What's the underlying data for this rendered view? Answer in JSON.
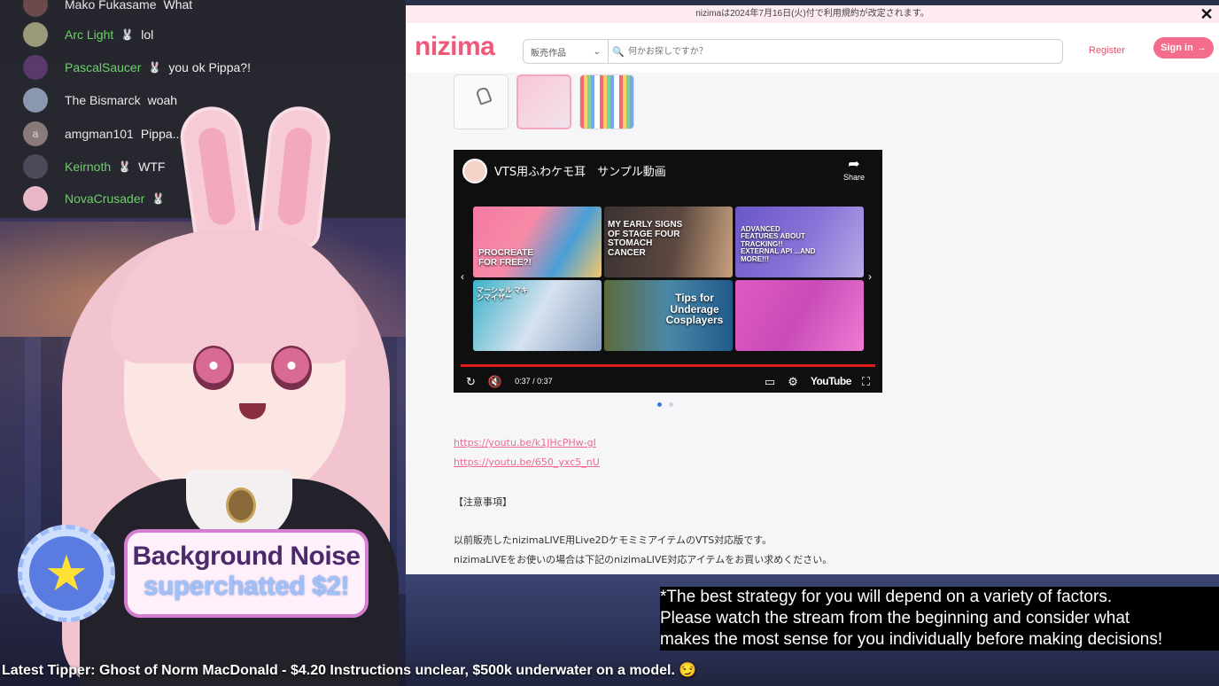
{
  "chat": {
    "messages": [
      {
        "name": "Mako Fukasame",
        "message": "What",
        "avatar_color": "#6a4a4a",
        "name_color": "white"
      },
      {
        "name": "Arc Light",
        "message": "lol",
        "avatar_color": "#9a9a7a",
        "name_color": "green",
        "badge": "🐰"
      },
      {
        "name": "PascalSaucer",
        "message": "you ok Pippa?!",
        "avatar_color": "#5a3a6a",
        "name_color": "green",
        "badge": "🐰"
      },
      {
        "name": "The Bismarck",
        "message": "woah",
        "avatar_color": "#8a98b0",
        "name_color": "white"
      },
      {
        "name": "amgman101",
        "message": "Pippa..",
        "avatar_color": "#8a7a7a",
        "avatar_letter": "a",
        "name_color": "white"
      },
      {
        "name": "Keirnoth",
        "message": "WTF",
        "avatar_color": "#4a4a5a",
        "name_color": "green",
        "badge": "🐰"
      },
      {
        "name": "NovaCrusader",
        "message": "",
        "avatar_color": "#e8b8c8",
        "name_color": "green",
        "badge": "🐰"
      }
    ]
  },
  "superchat": {
    "name": "Background Noise",
    "text": "superchatted $2!"
  },
  "browser": {
    "notice": "nizimaは2024年7月16日(火)付で利用規約が改定されます。",
    "logo": "nizima",
    "category_select": "販売作品",
    "search_placeholder": "何かお探しですか？",
    "register": "Register",
    "signin": "Sign in",
    "video": {
      "title": "VTS用ふわケモ耳　サンプル動画",
      "share": "Share",
      "time": "0:37 / 0:37",
      "progress": 1.0,
      "yt_logo": "YouTube",
      "tiles": [
        {
          "text": "PROCREATE FOR FREE?!"
        },
        {
          "text": "MY EARLY SIGNS OF STAGE FOUR STOMACH CANCER"
        },
        {
          "text": "ADVANCED FEATURES ABOUT TRACKING!! EXTERNAL API ...AND MORE!!!"
        },
        {
          "text": "マーシャル マキシマイザー"
        },
        {
          "text": "Tips for Underage Cosplayers"
        },
        {
          "text": ""
        }
      ]
    },
    "links": [
      "https://youtu.be/k1JHcPHw-gI",
      "https://youtu.be/650_yxc5_nU"
    ],
    "notes_heading": "【注意事項】",
    "notes": [
      "以前販売したnizimaLIVE用Live2DケモミミアイテムのVTS対応版です。",
      "nizimaLIVEをお使いの場合は下記のnizimaLIVE対応アイテムをお買い求めください。"
    ]
  },
  "captions": {
    "lines": [
      "*The best strategy for you will depend on a variety of factors.",
      "Please watch the stream from the beginning and consider what",
      "makes the most sense for you individually before making decisions!"
    ]
  },
  "ticker": {
    "text": "Latest Tipper: Ghost of Norm MacDonald - $4.20 Instructions unclear, $500k underwater on a model. 😏"
  }
}
